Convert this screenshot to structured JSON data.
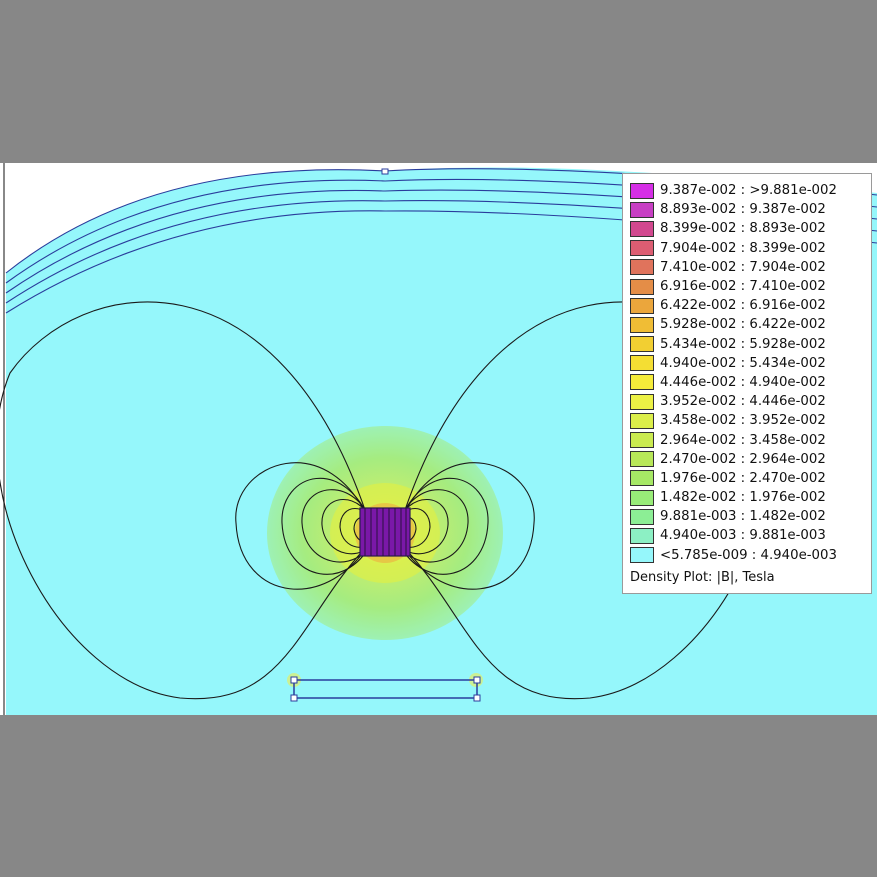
{
  "legend": {
    "caption": "Density Plot: |B|, Tesla",
    "entries": [
      {
        "label": "9.387e-002 : >9.881e-002",
        "color": "#d52ee6"
      },
      {
        "label": "8.893e-002 : 9.387e-002",
        "color": "#c83fc4"
      },
      {
        "label": "8.399e-002 : 8.893e-002",
        "color": "#d2488f"
      },
      {
        "label": "7.904e-002 : 8.399e-002",
        "color": "#dc5d72"
      },
      {
        "label": "7.410e-002 : 7.904e-002",
        "color": "#e0735c"
      },
      {
        "label": "6.916e-002 : 7.410e-002",
        "color": "#e48d47"
      },
      {
        "label": "6.422e-002 : 6.916e-002",
        "color": "#eba63c"
      },
      {
        "label": "5.928e-002 : 6.422e-002",
        "color": "#f0bd35"
      },
      {
        "label": "5.434e-002 : 5.928e-002",
        "color": "#f2cf32"
      },
      {
        "label": "4.940e-002 : 5.434e-002",
        "color": "#f4de33"
      },
      {
        "label": "4.446e-002 : 4.940e-002",
        "color": "#f5ec3a"
      },
      {
        "label": "3.952e-002 : 4.446e-002",
        "color": "#ecf145"
      },
      {
        "label": "3.458e-002 : 3.952e-002",
        "color": "#dcef4a"
      },
      {
        "label": "2.964e-002 : 3.458e-002",
        "color": "#cbeb50"
      },
      {
        "label": "2.470e-002 : 2.964e-002",
        "color": "#b8e858"
      },
      {
        "label": "1.976e-002 : 2.470e-002",
        "color": "#a6e865"
      },
      {
        "label": "1.482e-002 : 1.976e-002",
        "color": "#98ec78"
      },
      {
        "label": "9.881e-003 : 1.482e-002",
        "color": "#8cee95"
      },
      {
        "label": "4.940e-003 : 9.881e-003",
        "color": "#8cf0c4"
      },
      {
        "label": "<5.785e-009 : 4.940e-003",
        "color": "#95f7fb"
      }
    ]
  },
  "colors": {
    "background_field": "#95f7fb",
    "contour_line": "#1a1a1a",
    "boundary_line": "#2a3d9c",
    "coil": "#7a18a8"
  }
}
